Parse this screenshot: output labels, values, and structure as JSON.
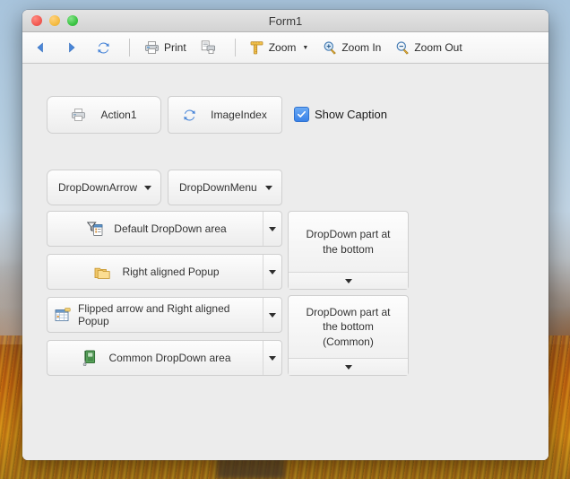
{
  "window": {
    "title": "Form1",
    "traffic_lights": [
      {
        "name": "close",
        "color": "#f25a52"
      },
      {
        "name": "minimize",
        "color": "#f5bb43"
      },
      {
        "name": "zoom",
        "color": "#3bc443"
      }
    ]
  },
  "toolbar": {
    "items": [
      {
        "name": "back",
        "icon": "back-arrow-icon",
        "label": ""
      },
      {
        "name": "forward",
        "icon": "forward-arrow-icon",
        "label": ""
      },
      {
        "name": "refresh",
        "icon": "refresh-icon",
        "label": ""
      },
      {
        "name": "separator1",
        "icon": "separator",
        "label": ""
      },
      {
        "name": "print",
        "icon": "printer-icon",
        "label": "Print"
      },
      {
        "name": "print-preview",
        "icon": "print-preview-icon",
        "label": ""
      },
      {
        "name": "separator2",
        "icon": "separator",
        "label": ""
      },
      {
        "name": "zoom",
        "icon": "ruler-icon",
        "label": "Zoom",
        "has_arrow": true
      },
      {
        "name": "zoom-in",
        "icon": "zoom-in-icon",
        "label": "Zoom In"
      },
      {
        "name": "zoom-out",
        "icon": "zoom-out-icon",
        "label": "Zoom Out"
      }
    ],
    "back_label": "",
    "forward_label": "",
    "refresh_label": "",
    "print_label": "Print",
    "preview_label": "",
    "zoom_label": "Zoom",
    "zoom_in_label": "Zoom In",
    "zoom_out_label": "Zoom Out"
  },
  "client": {
    "action_button": {
      "label": "Action1",
      "icon": "printer-icon"
    },
    "imageindex_button": {
      "label": "ImageIndex",
      "icon": "refresh-icon"
    },
    "show_caption": {
      "label": "Show Caption",
      "checked": true
    },
    "dropdown_arrow_combo": {
      "label": "DropDownArrow"
    },
    "dropdown_menu_combo": {
      "label": "DropDownMenu"
    },
    "split_buttons": [
      {
        "label": "Default DropDown area",
        "icon": "filter-list-icon"
      },
      {
        "label": "Right aligned Popup",
        "icon": "folder-icon"
      },
      {
        "label": "Flipped arrow and Right aligned Popup",
        "icon": "grid-table-icon"
      },
      {
        "label": "Common DropDown area",
        "icon": "green-notebook-icon"
      }
    ],
    "panels": [
      {
        "text": "DropDown part at the bottom"
      },
      {
        "text": "DropDown part at the bottom (Common)"
      }
    ]
  },
  "colors": {
    "accent_blue": "#3a82e8",
    "window_bg": "#ececec",
    "toolbar_bg": "#f6f6f6",
    "border": "#cfcfcf"
  }
}
